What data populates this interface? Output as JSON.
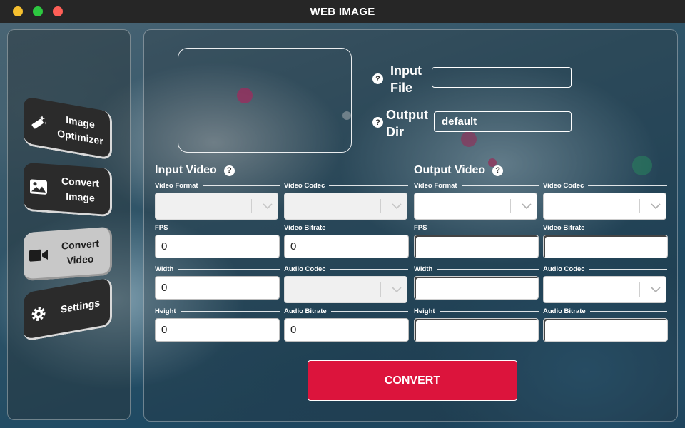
{
  "window": {
    "title": "WEB IMAGE"
  },
  "sidebar": {
    "items": [
      {
        "label": "Image\nOptimizer",
        "icon": "magic-wand-icon"
      },
      {
        "label": "Convert\nImage",
        "icon": "image-icon"
      },
      {
        "label": "Convert\nVideo",
        "icon": "video-camera-icon",
        "active": true
      },
      {
        "label": "Settings",
        "icon": "gear-icon"
      }
    ]
  },
  "io": {
    "help_glyph": "?",
    "input_file_label": "Input\nFile",
    "input_file_value": "",
    "output_dir_label": "Output\nDir",
    "output_dir_value": "default"
  },
  "input_video": {
    "title": "Input Video",
    "video_format_label": "Video Format",
    "video_codec_label": "Video Codec",
    "fps_label": "FPS",
    "fps_value": "0",
    "video_bitrate_label": "Video Bitrate",
    "video_bitrate_value": "0",
    "width_label": "Width",
    "width_value": "0",
    "audio_codec_label": "Audio Codec",
    "height_label": "Height",
    "height_value": "0",
    "audio_bitrate_label": "Audio Bitrate",
    "audio_bitrate_value": "0"
  },
  "output_video": {
    "title": "Output Video",
    "video_format_label": "Video Format",
    "video_codec_label": "Video Codec",
    "fps_label": "FPS",
    "fps_value": "",
    "video_bitrate_label": "Video Bitrate",
    "video_bitrate_value": "",
    "width_label": "Width",
    "width_value": "",
    "audio_codec_label": "Audio Codec",
    "height_label": "Height",
    "height_value": "",
    "audio_bitrate_label": "Audio Bitrate",
    "audio_bitrate_value": ""
  },
  "convert_button": {
    "label": "CONVERT"
  },
  "colors": {
    "accent": "#dc143c",
    "titlebar": "#262626",
    "traffic_yellow": "#f5bf2f",
    "traffic_green": "#2dc840",
    "traffic_red": "#fe5f57"
  }
}
